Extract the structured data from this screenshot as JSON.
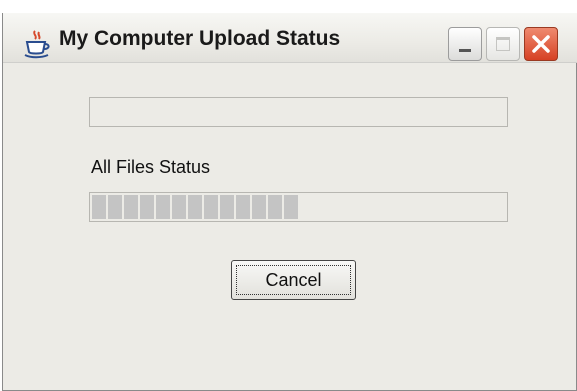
{
  "window": {
    "title": "My Computer Upload Status",
    "icon": "java-cup-icon",
    "controls": {
      "minimize": "minimize-icon",
      "maximize": "maximize-icon",
      "close": "close-icon"
    }
  },
  "current_file_progress": {
    "fraction": 0.0
  },
  "all_files": {
    "label": "All Files Status",
    "progress_fraction": 0.5
  },
  "actions": {
    "cancel_label": "Cancel"
  },
  "colors": {
    "window_bg": "#ecebe6",
    "progress_block": "#c4c4c4",
    "close_button": "#d64124"
  }
}
